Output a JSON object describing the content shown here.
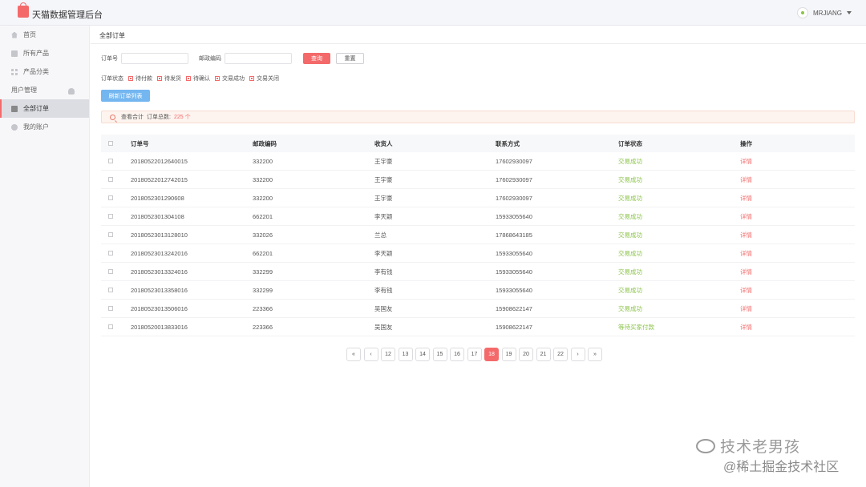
{
  "app": {
    "title": "天猫数据管理后台",
    "user": "MRJIANG"
  },
  "sidebar": {
    "items": [
      {
        "label": "首页",
        "icon": "home-icon"
      },
      {
        "label": "所有产品",
        "icon": "product-icon"
      },
      {
        "label": "产品分类",
        "icon": "category-icon"
      },
      {
        "label": "用户管理",
        "icon": "user-icon"
      },
      {
        "label": "全部订单",
        "icon": "order-icon",
        "active": true
      },
      {
        "label": "我的账户",
        "icon": "gear-icon"
      }
    ]
  },
  "breadcrumb": "全部订单",
  "filter": {
    "order_no_label": "订单号",
    "order_no_value": "",
    "zip_label": "邮政编码",
    "zip_value": "",
    "query_label": "查询",
    "reset_label": "重置"
  },
  "status_filter": {
    "label": "订单状态",
    "options": [
      "待付款",
      "待发货",
      "待确认",
      "交易成功",
      "交易关闭"
    ]
  },
  "refresh_label": "刷新订单列表",
  "summary": {
    "label": "查看合计",
    "total_label": "订单总数:",
    "total_value": "225 个"
  },
  "table": {
    "headers": [
      "订单号",
      "邮政编码",
      "收货人",
      "联系方式",
      "订单状态",
      "操作"
    ],
    "rows": [
      [
        "20180522012640015",
        "332200",
        "王宇豪",
        "17602930097",
        "交易成功",
        "详情"
      ],
      [
        "20180522012742015",
        "332200",
        "王宇豪",
        "17602930097",
        "交易成功",
        "详情"
      ],
      [
        "2018052301290608",
        "332200",
        "王宇豪",
        "17602930097",
        "交易成功",
        "详情"
      ],
      [
        "2018052301304108",
        "662201",
        "李天颖",
        "15933055640",
        "交易成功",
        "详情"
      ],
      [
        "20180523013128010",
        "332026",
        "兰总",
        "17868643185",
        "交易成功",
        "详情"
      ],
      [
        "20180523013242016",
        "662201",
        "李天颖",
        "15933055640",
        "交易成功",
        "详情"
      ],
      [
        "20180523013324016",
        "332299",
        "李有钱",
        "15933055640",
        "交易成功",
        "详情"
      ],
      [
        "20180523013358016",
        "332299",
        "李有钱",
        "15933055640",
        "交易成功",
        "详情"
      ],
      [
        "20180523013506016",
        "223366",
        "吴国友",
        "15908622147",
        "交易成功",
        "详情"
      ],
      [
        "20180520013833016",
        "223366",
        "吴国友",
        "15908622147",
        "等待买家付款",
        "详情"
      ]
    ]
  },
  "pagination": {
    "first": "«",
    "prev": "‹",
    "next": "›",
    "last": "»",
    "pages": [
      "12",
      "13",
      "14",
      "15",
      "16",
      "17",
      "18",
      "19",
      "20",
      "21",
      "22"
    ],
    "current": "18"
  },
  "watermark": {
    "line1": "技术老男孩",
    "line2": "@稀土掘金技术社区"
  },
  "colors": {
    "accent": "#f46a6a",
    "success": "#8bc34a",
    "refresh": "#74b6f0"
  }
}
